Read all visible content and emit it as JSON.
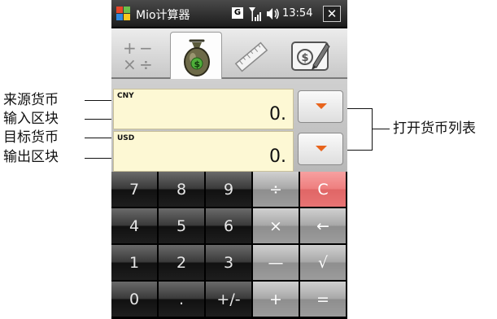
{
  "status_bar": {
    "app_title": "Mio计算器",
    "network_badge": "G",
    "time": "13:54",
    "close_label": "✕"
  },
  "tabs": [
    {
      "name": "basic-calc",
      "icon": "arithmetic-icon",
      "active": false
    },
    {
      "name": "currency",
      "icon": "money-bag-icon",
      "active": true
    },
    {
      "name": "unit-converter",
      "icon": "ruler-icon",
      "active": false
    },
    {
      "name": "tip-calc",
      "icon": "bill-pen-icon",
      "active": false
    }
  ],
  "fields": {
    "source_currency": "CNY",
    "input_value": "0.",
    "target_currency": "USD",
    "output_value": "0."
  },
  "keypad": {
    "keys": [
      "7",
      "8",
      "9",
      "÷",
      "C",
      "4",
      "5",
      "6",
      "×",
      "←",
      "1",
      "2",
      "3",
      "—",
      "√",
      "0",
      ".",
      "+/-",
      "+",
      "="
    ]
  },
  "annotations": {
    "source_currency": "来源货币",
    "input_block": "输入区块",
    "target_currency": "目标货币",
    "output_block": "输出区块",
    "open_currency_list": "打开货币列表"
  },
  "colors": {
    "field_bg": "#fdf8d4",
    "dropdown_arrow": "#e8641c",
    "clear_key": "#ee7f7f",
    "operator_key": "#a8a8a8",
    "digit_key": "#3a3a3a"
  }
}
